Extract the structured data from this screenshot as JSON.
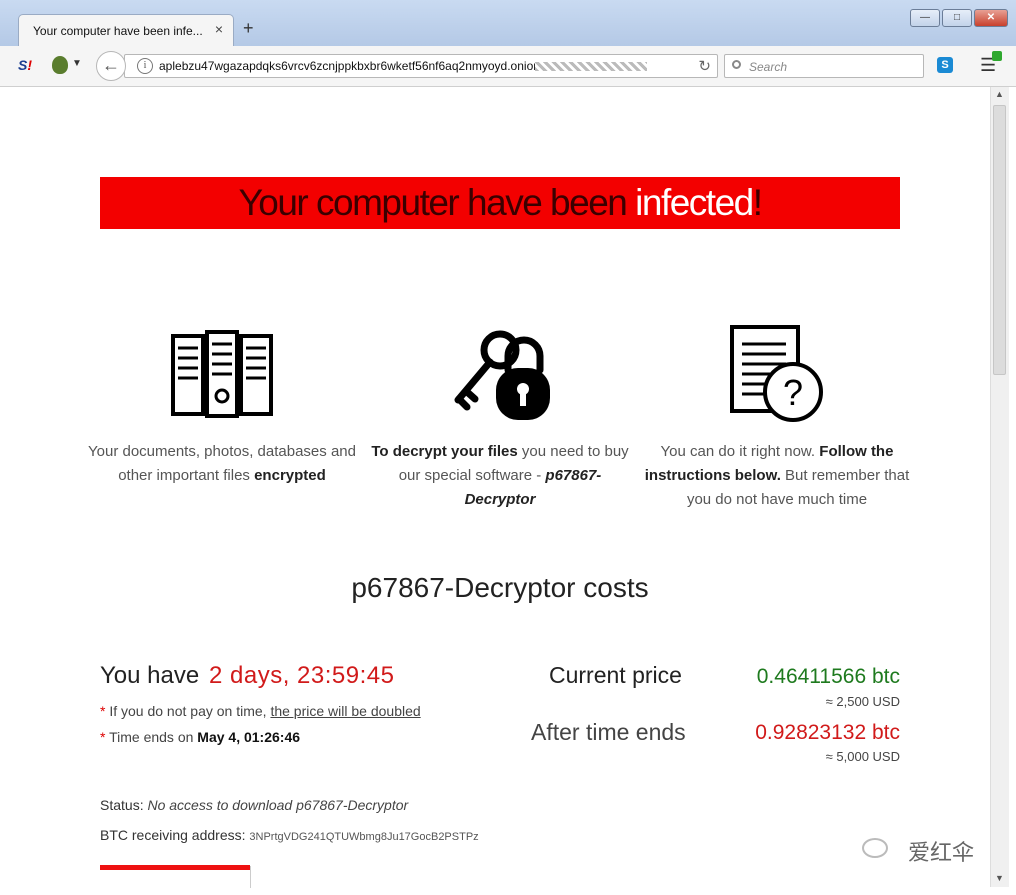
{
  "browser": {
    "tab_title": "Your computer have been infe...",
    "tab_close": "×",
    "new_tab": "+",
    "url": "aplebzu47wgazapdqks6vrcv6zcnjppkbxbr6wketf56nf6aq2nmyoyd.onion",
    "search_placeholder": "Search"
  },
  "page": {
    "banner": {
      "part1": "Your computer have been ",
      "part2": "infected",
      "part3": "!"
    },
    "features": [
      {
        "icon": "server-icon",
        "text_a": "Your documents, photos, databases and other important files ",
        "bold": "encrypted"
      },
      {
        "icon": "key-lock-icon",
        "bold": "To decrypt your files",
        "text_a": " you need to buy our special software - ",
        "italic": "p67867-Decryptor"
      },
      {
        "icon": "document-question-icon",
        "text_a": "You can do it right now. ",
        "bold": "Follow the instructions below.",
        "text_b": " But remember that you do not have much time"
      }
    ],
    "cost_title": "p67867-Decryptor costs",
    "timer": {
      "label": "You have",
      "value": "2 days, 23:59:45",
      "note1_prefix": "If you do not pay on time, ",
      "note1_link": "the price will be doubled",
      "note2_prefix": "Time ends on ",
      "note2_value": "May 4, 01:26:46"
    },
    "prices": {
      "current_label": "Current price",
      "current_btc": "0.46411566 btc",
      "current_usd": "≈ 2,500 USD",
      "after_label": "After time ends",
      "after_btc": "0.92823132 btc",
      "after_usd": "≈ 5,000 USD"
    },
    "status_label": "Status: ",
    "status_value": "No access to download p67867-Decryptor",
    "btc_label": "BTC receiving address: ",
    "btc_address": "3NPrtgVDG241QTUWbmg8Ju17GocB2PSTPz"
  },
  "watermark": "爱红伞",
  "colors": {
    "banner": "#f30000",
    "red": "#d11a1a",
    "green": "#1e7a1e"
  }
}
